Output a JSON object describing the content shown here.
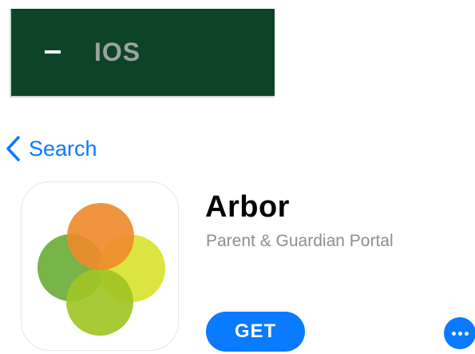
{
  "banner": {
    "dash": "–",
    "label": "IOS",
    "background": "#0d4427",
    "label_color": "#9ba5a0"
  },
  "nav": {
    "back_label": "Search",
    "back_icon": "chevron-left-icon"
  },
  "app": {
    "name": "Arbor",
    "subtitle": "Parent & Guardian Portal",
    "icon": "arbor-logo-icon",
    "get_label": "GET",
    "more_icon": "ellipsis-icon"
  },
  "colors": {
    "accent": "#0a7aff",
    "text_primary": "#000000",
    "text_secondary": "#8e8e93",
    "logo_orange": "#ee8a2a",
    "logo_green": "#6bae3a",
    "logo_yellow": "#d8e22a",
    "logo_lime": "#9fc625"
  }
}
